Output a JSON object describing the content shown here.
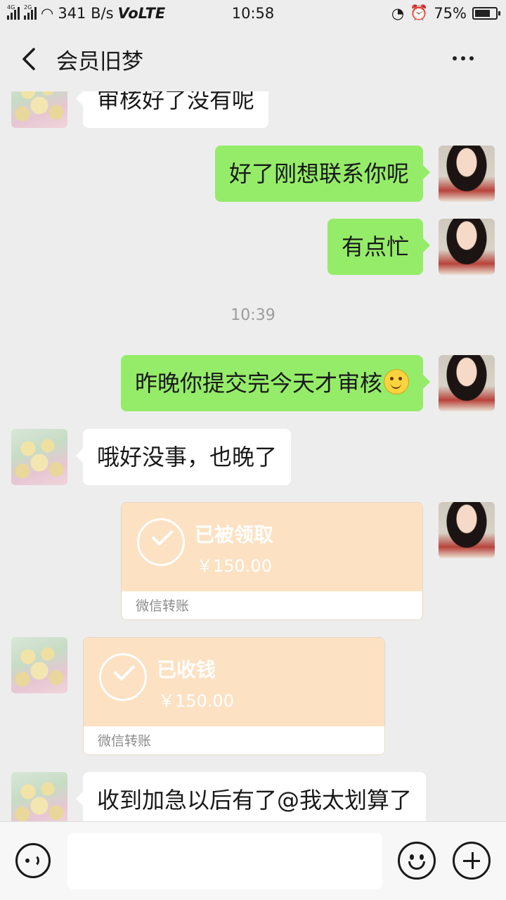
{
  "status_bar": {
    "net1": "4G",
    "net2": "2G",
    "speed": "341 B/s",
    "volte": "VoLTE",
    "time": "10:58",
    "battery": "75%",
    "battery_level": 0.75
  },
  "header": {
    "title": "会员旧梦"
  },
  "messages": [
    {
      "from": "other",
      "text": "审核好了没有呢"
    },
    {
      "from": "self",
      "text": "好了刚想联系你呢"
    },
    {
      "from": "self",
      "text": "有点忙"
    },
    {
      "from": "self",
      "text": "昨晚你提交完今天才审核"
    },
    {
      "from": "other",
      "text": "哦好没事，也晚了"
    },
    {
      "from": "self",
      "text": "收到加急以后有了@我太划算了"
    }
  ],
  "timestamp": "10:39",
  "transfers": [
    {
      "from": "self",
      "status": "已被领取",
      "amount": "￥150.00",
      "label": "微信转账"
    },
    {
      "from": "other",
      "status": "已收钱",
      "amount": "￥150.00",
      "label": "微信转账"
    }
  ],
  "icons": {
    "back": "chevron-left-icon",
    "more": "more-dots-icon",
    "voice": "voice-icon",
    "emoji": "emoji-icon",
    "plus": "plus-icon",
    "smiley": "smiley-emoji"
  }
}
